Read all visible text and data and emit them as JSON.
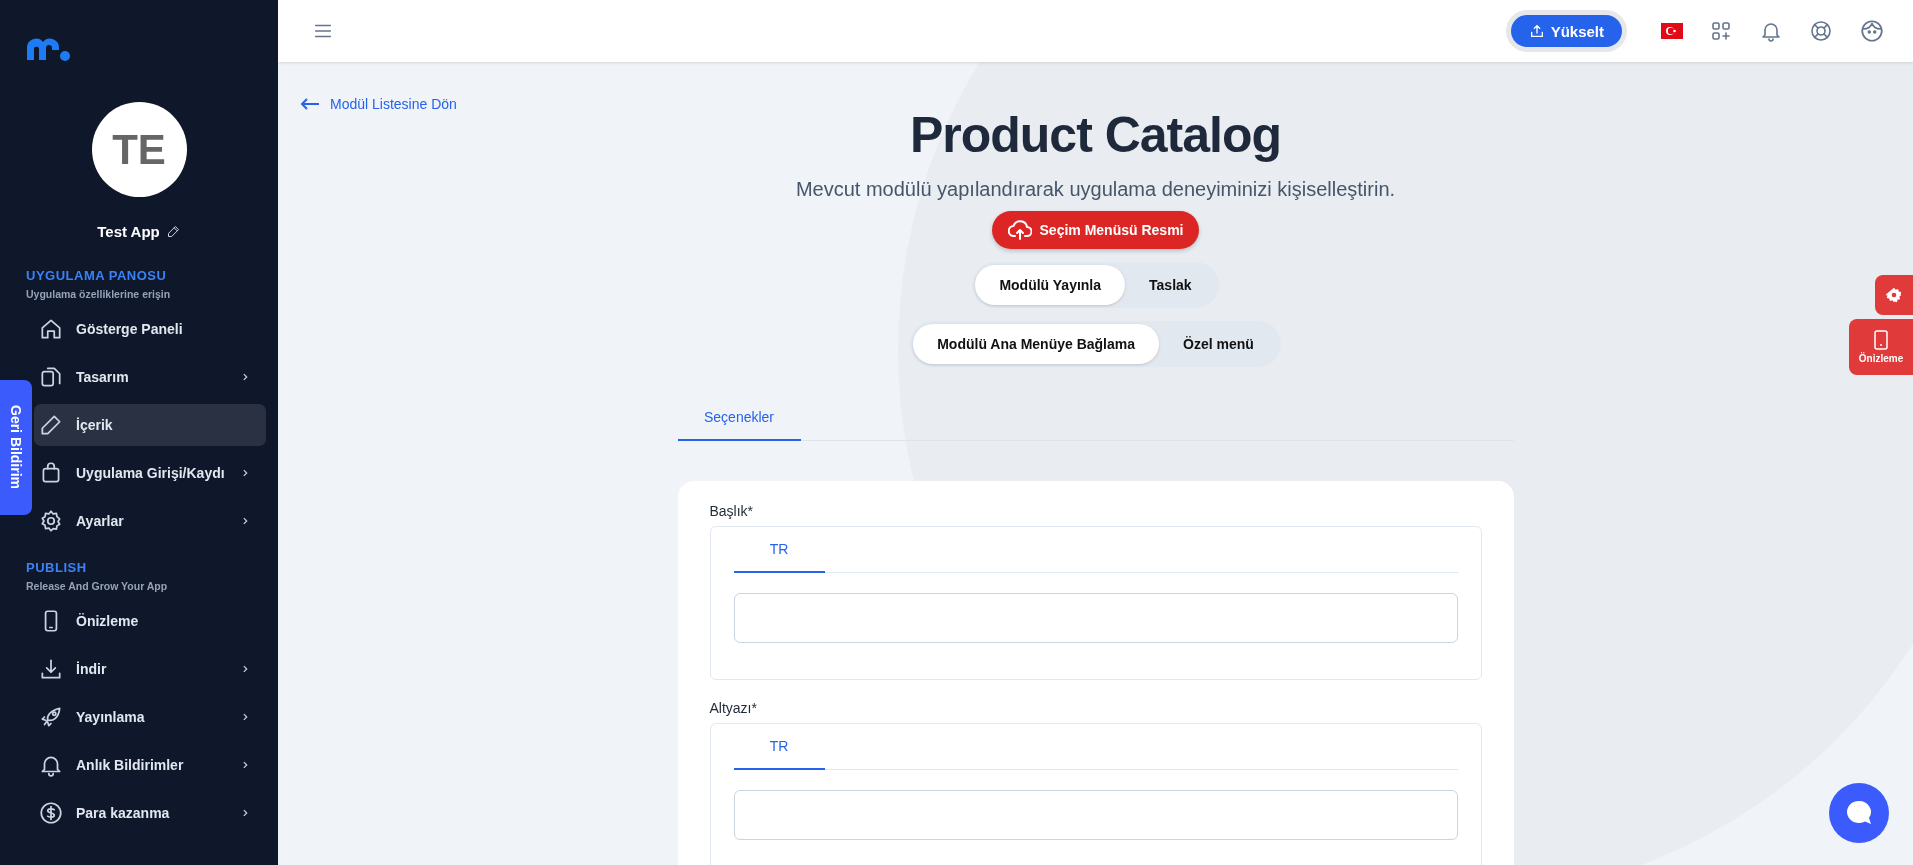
{
  "sidebar": {
    "profile": {
      "initials": "TE",
      "name": "Test App"
    },
    "sections": [
      {
        "title": "UYGULAMA PANOSU",
        "subtitle": "Uygulama özelliklerine erişin",
        "items": [
          {
            "label": "Gösterge Paneli",
            "expandable": false,
            "selected": false
          },
          {
            "label": "Tasarım",
            "expandable": true,
            "selected": false
          },
          {
            "label": "İçerik",
            "expandable": false,
            "selected": true
          },
          {
            "label": "Uygulama Girişi/Kaydı",
            "expandable": true,
            "selected": false
          },
          {
            "label": "Ayarlar",
            "expandable": true,
            "selected": false
          }
        ]
      },
      {
        "title": "PUBLISH",
        "subtitle": "Release And Grow Your App",
        "items": [
          {
            "label": "Önizleme",
            "expandable": false,
            "selected": false
          },
          {
            "label": "İndir",
            "expandable": true,
            "selected": false
          },
          {
            "label": "Yayınlama",
            "expandable": true,
            "selected": false
          },
          {
            "label": "Anlık Bildirimler",
            "expandable": true,
            "selected": false
          },
          {
            "label": "Para kazanma",
            "expandable": true,
            "selected": false
          }
        ]
      }
    ]
  },
  "feedback_tab": {
    "label": "Geri Bildirim"
  },
  "header": {
    "upgrade_button": "Yükselt"
  },
  "back_link": "Modül Listesine Dön",
  "title": "Product Catalog",
  "subtitle": "Mevcut modülü yapılandırarak uygulama deneyiminizi kişiselleştirin.",
  "image_button": "Seçim Menüsü Resmi",
  "status_toggle": [
    {
      "label": "Modülü Yayınla",
      "selected": true
    },
    {
      "label": "Taslak",
      "selected": false
    }
  ],
  "menu_toggle": [
    {
      "label": "Modülü Ana Menüye Bağlama",
      "selected": true
    },
    {
      "label": "Özel menü",
      "selected": false
    }
  ],
  "tabs": [
    {
      "label": "Seçenekler",
      "selected": true
    }
  ],
  "fields": [
    {
      "label": "Başlık*",
      "languages": [
        {
          "label": "TR",
          "selected": true
        }
      ]
    },
    {
      "label": "Altyazı*",
      "languages": [
        {
          "label": "TR",
          "selected": true
        }
      ]
    }
  ],
  "floating_actions": {
    "preview_label": "Önizleme"
  }
}
